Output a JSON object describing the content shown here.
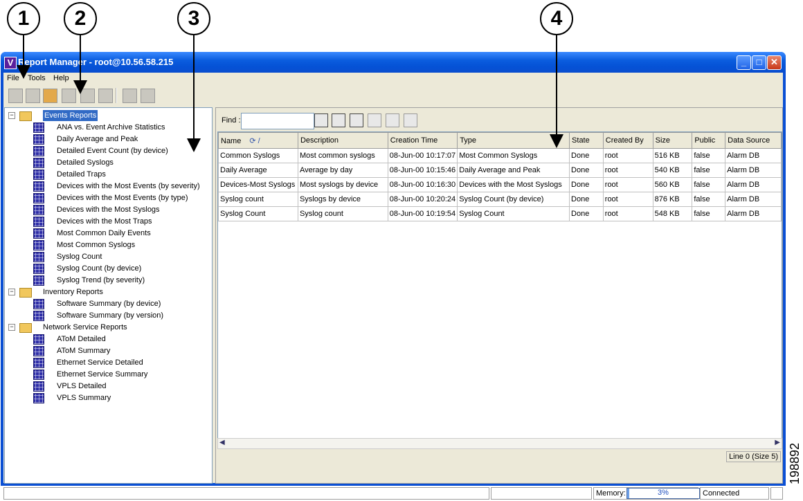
{
  "window": {
    "title": "Report Manager - root@10.56.58.215",
    "app_icon_letter": "V",
    "controls": {
      "minimize": "_",
      "maximize": "□",
      "close": "✕"
    }
  },
  "callouts": [
    "1",
    "2",
    "3",
    "4"
  ],
  "figure_number": "198892",
  "menubar": [
    {
      "label": "File"
    },
    {
      "label": "Tools"
    },
    {
      "label": "Help"
    }
  ],
  "toolbar_icons": [
    "table-icon",
    "add-table-icon",
    "open-report-icon",
    "link-icon",
    "monitor-icon",
    "trash-icon",
    "disk-icon",
    "camera-icon"
  ],
  "tree": [
    {
      "type": "folder",
      "label": "Events Reports",
      "selected": true,
      "expanded": true
    },
    {
      "type": "leaf",
      "label": "ANA vs. Event Archive Statistics"
    },
    {
      "type": "leaf",
      "label": "Daily Average and Peak"
    },
    {
      "type": "leaf",
      "label": "Detailed Event Count (by device)"
    },
    {
      "type": "leaf",
      "label": "Detailed Syslogs"
    },
    {
      "type": "leaf",
      "label": "Detailed Traps"
    },
    {
      "type": "leaf",
      "label": "Devices with the Most Events (by severity)"
    },
    {
      "type": "leaf",
      "label": "Devices with the Most Events (by type)"
    },
    {
      "type": "leaf",
      "label": "Devices with the Most Syslogs"
    },
    {
      "type": "leaf",
      "label": "Devices with the Most Traps"
    },
    {
      "type": "leaf",
      "label": "Most Common Daily Events"
    },
    {
      "type": "leaf",
      "label": "Most Common Syslogs"
    },
    {
      "type": "leaf",
      "label": "Syslog Count"
    },
    {
      "type": "leaf",
      "label": "Syslog Count (by device)"
    },
    {
      "type": "leaf",
      "label": "Syslog Trend (by severity)"
    },
    {
      "type": "folder",
      "label": "Inventory Reports",
      "expanded": true
    },
    {
      "type": "leaf",
      "label": "Software Summary (by device)"
    },
    {
      "type": "leaf",
      "label": "Software Summary (by version)"
    },
    {
      "type": "folder",
      "label": "Network Service Reports",
      "expanded": true
    },
    {
      "type": "leaf",
      "label": "AToM Detailed"
    },
    {
      "type": "leaf",
      "label": "AToM Summary"
    },
    {
      "type": "leaf",
      "label": "Ethernet Service Detailed"
    },
    {
      "type": "leaf",
      "label": "Ethernet Service Summary"
    },
    {
      "type": "leaf",
      "label": "VPLS Detailed"
    },
    {
      "type": "leaf",
      "label": "VPLS Summary"
    }
  ],
  "find": {
    "label": "Find :",
    "value": ""
  },
  "find_icons": [
    "details-icon",
    "sort-az-icon",
    "filter-icon",
    "filter-clear-icon",
    "export-icon",
    "import-icon"
  ],
  "table": {
    "columns": [
      "Name",
      "Description",
      "Creation Time",
      "Type",
      "State",
      "Created By",
      "Size",
      "Public",
      "Data Source"
    ],
    "sort_indicator": "⟳ /",
    "rows": [
      [
        "Common Syslogs",
        "Most common syslogs",
        "08-Jun-00 10:17:07",
        "Most Common Syslogs",
        "Done",
        "root",
        "516 KB",
        "false",
        "Alarm DB"
      ],
      [
        "Daily Average",
        "Average by day",
        "08-Jun-00 10:15:46",
        "Daily Average and Peak",
        "Done",
        "root",
        "540 KB",
        "false",
        "Alarm DB"
      ],
      [
        "Devices-Most Syslogs",
        "Most syslogs by device",
        "08-Jun-00 10:16:30",
        "Devices with the Most Syslogs",
        "Done",
        "root",
        "560 KB",
        "false",
        "Alarm DB"
      ],
      [
        "Syslog count",
        "Syslogs by device",
        "08-Jun-00 10:20:24",
        "Syslog Count (by device)",
        "Done",
        "root",
        "876 KB",
        "false",
        "Alarm DB"
      ],
      [
        "Syslog Count",
        "Syslog count",
        "08-Jun-00 10:19:54",
        "Syslog Count",
        "Done",
        "root",
        "548 KB",
        "false",
        "Alarm DB"
      ]
    ]
  },
  "line_info": "Line 0 (Size 5)",
  "status": {
    "memory_label": "Memory:",
    "memory_value": "3%",
    "memory_fraction": 0.03,
    "connection": "Connected"
  },
  "colors": {
    "titlebar": "#0a4fd4",
    "selection": "#316ac5",
    "chrome": "#ece9d8"
  }
}
